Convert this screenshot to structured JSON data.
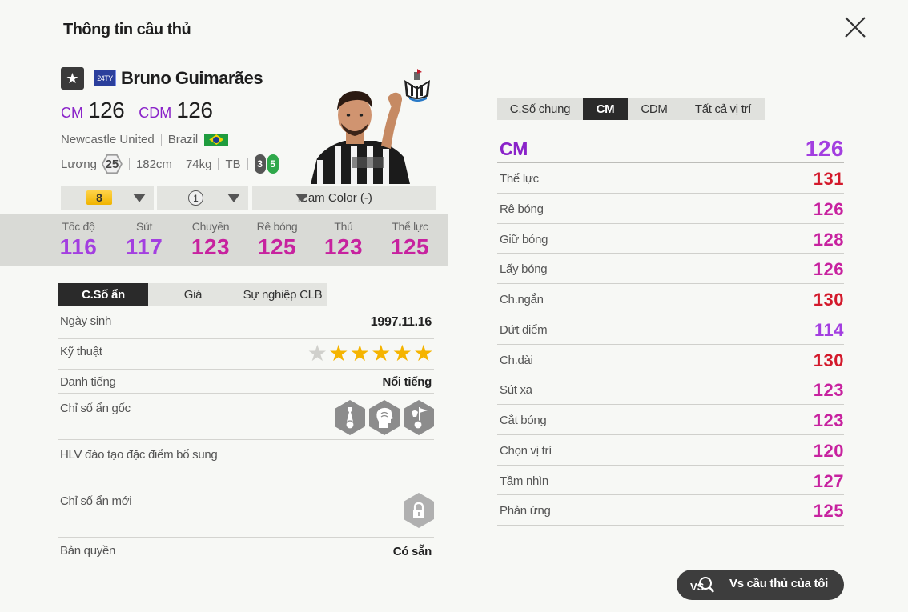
{
  "title": "Thông tin cầu thủ",
  "player": {
    "season": "24TY",
    "name": "Bruno Guimarães",
    "positions": [
      {
        "label": "CM",
        "value": "126"
      },
      {
        "label": "CDM",
        "value": "126"
      }
    ],
    "club": "Newcastle United",
    "nation": "Brazil",
    "salary_label": "Lương",
    "salary": "25",
    "height": "182cm",
    "weight": "74kg",
    "body_type": "TB",
    "weak_foot_left": "3",
    "weak_foot_right": "5"
  },
  "selectors": {
    "level": "8",
    "team_chemistry": "1",
    "team_color": "Team Color (-)"
  },
  "summary_stats": [
    {
      "label": "Tốc độ",
      "value": "116",
      "color": "#a33fe0"
    },
    {
      "label": "Sút",
      "value": "117",
      "color": "#a33fe0"
    },
    {
      "label": "Chuyền",
      "value": "123",
      "color": "#c7229f"
    },
    {
      "label": "Rê bóng",
      "value": "125",
      "color": "#c7229f"
    },
    {
      "label": "Thủ",
      "value": "123",
      "color": "#c7229f"
    },
    {
      "label": "Thể lực",
      "value": "125",
      "color": "#c7229f"
    }
  ],
  "hidden_tabs": [
    "C.Số ẩn",
    "Giá",
    "Sự nghiệp CLB"
  ],
  "hidden": {
    "birth_label": "Ngày sinh",
    "birth_value": "1997.11.16",
    "skill_label": "Kỹ thuật",
    "skill_stars": 5,
    "skill_max": 6,
    "rep_label": "Danh tiếng",
    "rep_value": "Nổi tiếng",
    "traits_label": "Chỉ số ẩn gốc",
    "traits": [
      "tie-trait-icon",
      "head-trait-icon",
      "flag-trait-icon"
    ],
    "coach_label": "HLV đào tạo đặc điểm bổ sung",
    "new_label": "Chỉ số ẩn mới",
    "license_label": "Bản quyền",
    "license_value": "Có sẵn"
  },
  "right_tabs": [
    "C.Số chung",
    "CM",
    "CDM",
    "Tất cả vị trí"
  ],
  "right_header": {
    "label": "CM",
    "value": "126"
  },
  "detail_stats": [
    {
      "label": "Thể lực",
      "value": "131",
      "color": "#d3192b"
    },
    {
      "label": "Rê bóng",
      "value": "126",
      "color": "#c7229f"
    },
    {
      "label": "Giữ bóng",
      "value": "128",
      "color": "#c7229f"
    },
    {
      "label": "Lấy bóng",
      "value": "126",
      "color": "#c7229f"
    },
    {
      "label": "Ch.ngắn",
      "value": "130",
      "color": "#d3192b"
    },
    {
      "label": "Dứt điểm",
      "value": "114",
      "color": "#a33fe0"
    },
    {
      "label": "Ch.dài",
      "value": "130",
      "color": "#d3192b"
    },
    {
      "label": "Sút xa",
      "value": "123",
      "color": "#c7229f"
    },
    {
      "label": "Cắt bóng",
      "value": "123",
      "color": "#c7229f"
    },
    {
      "label": "Chọn vị trí",
      "value": "120",
      "color": "#c7229f"
    },
    {
      "label": "Tầm nhìn",
      "value": "127",
      "color": "#c7229f"
    },
    {
      "label": "Phản ứng",
      "value": "125",
      "color": "#c7229f"
    }
  ],
  "vs_button": "Vs cầu thủ của tôi",
  "colors": {
    "position": "#8a23c9",
    "purple": "#a33fe0",
    "magenta": "#c7229f",
    "red": "#d3192b"
  }
}
